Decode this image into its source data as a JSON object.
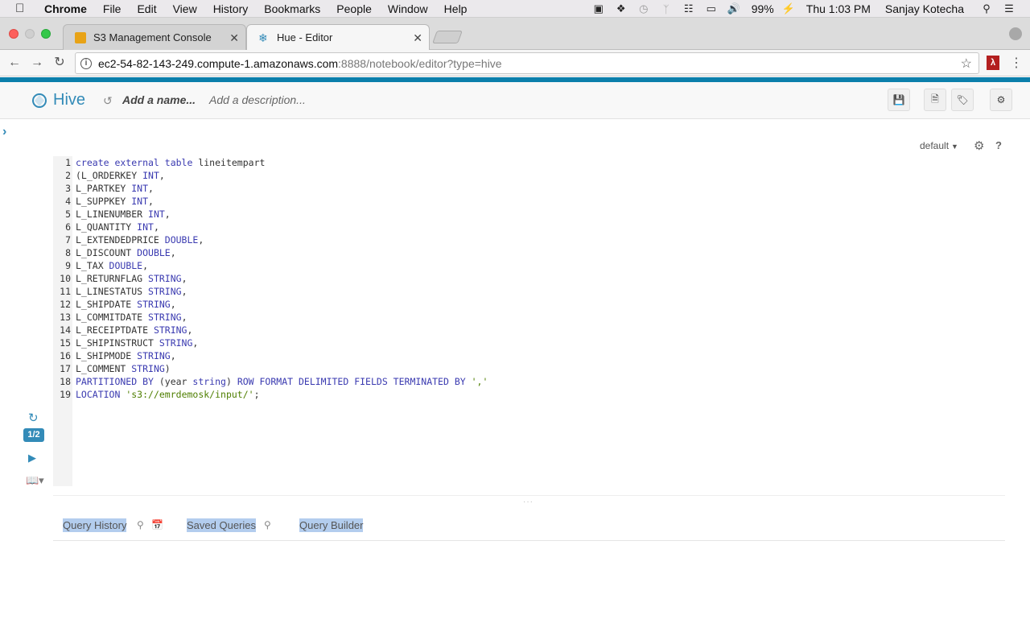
{
  "menubar": {
    "app": "Chrome",
    "items": [
      "File",
      "Edit",
      "View",
      "History",
      "Bookmarks",
      "People",
      "Window",
      "Help"
    ],
    "battery": "99%",
    "clock": "Thu 1:03 PM",
    "user": "Sanjay Kotecha"
  },
  "tabs": [
    {
      "title": "S3 Management Console",
      "favicon_color": "#e8a317"
    },
    {
      "title": "Hue - Editor",
      "favicon_color": "#338bb8"
    }
  ],
  "address": {
    "host": "ec2-54-82-143-249.compute-1.amazonaws.com",
    "path": ":8888/notebook/editor?type=hive"
  },
  "hue": {
    "title": "Hive",
    "name_placeholder": "Add a name...",
    "description_placeholder": "Add a description...",
    "database": "default",
    "page_indicator": "1/2"
  },
  "editor": {
    "lines": [
      {
        "n": "1",
        "parts": [
          {
            "t": "create external table",
            "c": "kw"
          },
          {
            "t": " lineitempart",
            "c": "txt"
          }
        ]
      },
      {
        "n": "2",
        "parts": [
          {
            "t": "(L_ORDERKEY ",
            "c": "txt"
          },
          {
            "t": "INT",
            "c": "kw"
          },
          {
            "t": ",",
            "c": "txt"
          }
        ]
      },
      {
        "n": "3",
        "parts": [
          {
            "t": "L_PARTKEY ",
            "c": "txt"
          },
          {
            "t": "INT",
            "c": "kw"
          },
          {
            "t": ",",
            "c": "txt"
          }
        ]
      },
      {
        "n": "4",
        "parts": [
          {
            "t": "L_SUPPKEY ",
            "c": "txt"
          },
          {
            "t": "INT",
            "c": "kw"
          },
          {
            "t": ",",
            "c": "txt"
          }
        ]
      },
      {
        "n": "5",
        "parts": [
          {
            "t": "L_LINENUMBER ",
            "c": "txt"
          },
          {
            "t": "INT",
            "c": "kw"
          },
          {
            "t": ",",
            "c": "txt"
          }
        ]
      },
      {
        "n": "6",
        "parts": [
          {
            "t": "L_QUANTITY ",
            "c": "txt"
          },
          {
            "t": "INT",
            "c": "kw"
          },
          {
            "t": ",",
            "c": "txt"
          }
        ]
      },
      {
        "n": "7",
        "parts": [
          {
            "t": "L_EXTENDEDPRICE ",
            "c": "txt"
          },
          {
            "t": "DOUBLE",
            "c": "kw"
          },
          {
            "t": ",",
            "c": "txt"
          }
        ]
      },
      {
        "n": "8",
        "parts": [
          {
            "t": "L_DISCOUNT ",
            "c": "txt"
          },
          {
            "t": "DOUBLE",
            "c": "kw"
          },
          {
            "t": ",",
            "c": "txt"
          }
        ]
      },
      {
        "n": "9",
        "parts": [
          {
            "t": "L_TAX ",
            "c": "txt"
          },
          {
            "t": "DOUBLE",
            "c": "kw"
          },
          {
            "t": ",",
            "c": "txt"
          }
        ]
      },
      {
        "n": "10",
        "parts": [
          {
            "t": "L_RETURNFLAG ",
            "c": "txt"
          },
          {
            "t": "STRING",
            "c": "kw"
          },
          {
            "t": ",",
            "c": "txt"
          }
        ]
      },
      {
        "n": "11",
        "parts": [
          {
            "t": "L_LINESTATUS ",
            "c": "txt"
          },
          {
            "t": "STRING",
            "c": "kw"
          },
          {
            "t": ",",
            "c": "txt"
          }
        ]
      },
      {
        "n": "12",
        "parts": [
          {
            "t": "L_SHIPDATE ",
            "c": "txt"
          },
          {
            "t": "STRING",
            "c": "kw"
          },
          {
            "t": ",",
            "c": "txt"
          }
        ]
      },
      {
        "n": "13",
        "parts": [
          {
            "t": "L_COMMITDATE ",
            "c": "txt"
          },
          {
            "t": "STRING",
            "c": "kw"
          },
          {
            "t": ",",
            "c": "txt"
          }
        ]
      },
      {
        "n": "14",
        "parts": [
          {
            "t": "L_RECEIPTDATE ",
            "c": "txt"
          },
          {
            "t": "STRING",
            "c": "kw"
          },
          {
            "t": ",",
            "c": "txt"
          }
        ]
      },
      {
        "n": "15",
        "parts": [
          {
            "t": "L_SHIPINSTRUCT ",
            "c": "txt"
          },
          {
            "t": "STRING",
            "c": "kw"
          },
          {
            "t": ",",
            "c": "txt"
          }
        ]
      },
      {
        "n": "16",
        "parts": [
          {
            "t": "L_SHIPMODE ",
            "c": "txt"
          },
          {
            "t": "STRING",
            "c": "kw"
          },
          {
            "t": ",",
            "c": "txt"
          }
        ]
      },
      {
        "n": "17",
        "parts": [
          {
            "t": "L_COMMENT ",
            "c": "txt"
          },
          {
            "t": "STRING",
            "c": "kw"
          },
          {
            "t": ")",
            "c": "txt"
          }
        ]
      },
      {
        "n": "18",
        "parts": [
          {
            "t": "PARTITIONED BY",
            "c": "kw"
          },
          {
            "t": " (year ",
            "c": "txt"
          },
          {
            "t": "string",
            "c": "kw"
          },
          {
            "t": ") ",
            "c": "txt"
          },
          {
            "t": "ROW FORMAT DELIMITED FIELDS TERMINATED BY",
            "c": "kw"
          },
          {
            "t": " ",
            "c": "txt"
          },
          {
            "t": "','",
            "c": "str"
          }
        ]
      },
      {
        "n": "19",
        "parts": [
          {
            "t": "LOCATION",
            "c": "kw"
          },
          {
            "t": " ",
            "c": "txt"
          },
          {
            "t": "'s3://emrdemosk/input/'",
            "c": "str"
          },
          {
            "t": ";",
            "c": "txt"
          }
        ]
      }
    ]
  },
  "bottom_tabs": {
    "query_history": "Query History",
    "saved_queries": "Saved Queries",
    "query_builder": "Query Builder"
  }
}
